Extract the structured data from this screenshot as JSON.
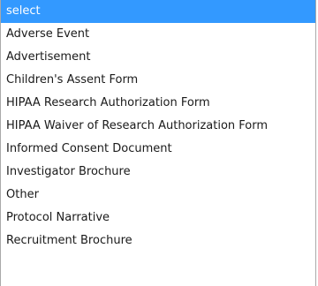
{
  "dropdown": {
    "selected_index": 0,
    "highlight_color": "#3399ff",
    "options": [
      {
        "label": "select"
      },
      {
        "label": "Adverse Event"
      },
      {
        "label": "Advertisement"
      },
      {
        "label": "Children's Assent Form"
      },
      {
        "label": "HIPAA Research Authorization Form"
      },
      {
        "label": "HIPAA Waiver of Research Authorization Form"
      },
      {
        "label": "Informed Consent Document"
      },
      {
        "label": "Investigator Brochure"
      },
      {
        "label": "Other"
      },
      {
        "label": "Protocol Narrative"
      },
      {
        "label": "Recruitment Brochure"
      }
    ]
  }
}
